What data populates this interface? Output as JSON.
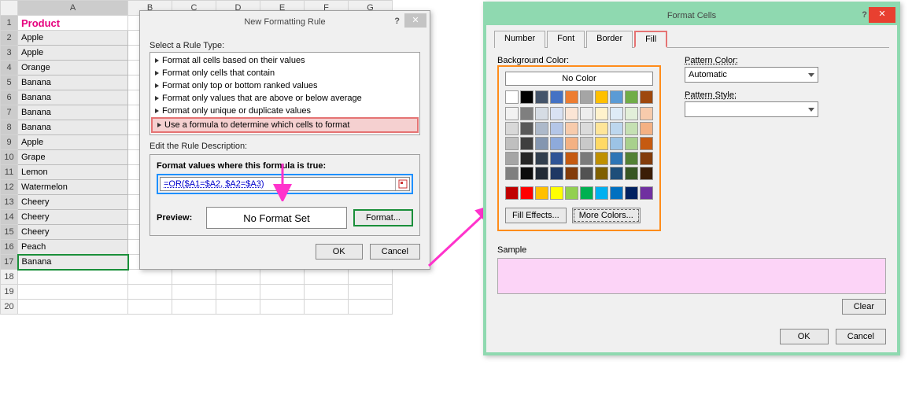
{
  "sheet": {
    "cols": [
      "A",
      "B",
      "C",
      "D",
      "E",
      "F",
      "G"
    ],
    "rows": [
      "1",
      "2",
      "3",
      "4",
      "5",
      "6",
      "7",
      "8",
      "9",
      "10",
      "11",
      "12",
      "13",
      "14",
      "15",
      "16",
      "17",
      "18",
      "19",
      "20"
    ],
    "header_cell": "Product",
    "data": [
      "Apple",
      "Apple",
      "Orange",
      "Banana",
      "Banana",
      "Banana",
      "Banana",
      "Apple",
      "Grape",
      "Lemon",
      "Watermelon",
      "Cheery",
      "Cheery",
      "Cheery",
      "Peach",
      "Banana"
    ]
  },
  "dlg1": {
    "title": "New Formatting Rule",
    "select_label": "Select a Rule Type:",
    "rules": [
      "Format all cells based on their values",
      "Format only cells that contain",
      "Format only top or bottom ranked values",
      "Format only values that are above or below average",
      "Format only unique or duplicate values",
      "Use a formula to determine which cells to format"
    ],
    "selected_rule": 5,
    "edit_label": "Edit the Rule Description:",
    "formula_label": "Format values where this formula is true:",
    "formula_value": "=OR($A1=$A2, $A2=$A3)",
    "preview_label": "Preview:",
    "preview_text": "No Format Set",
    "format_btn": "Format...",
    "ok": "OK",
    "cancel": "Cancel"
  },
  "dlg2": {
    "title": "Format Cells",
    "tabs": [
      "Number",
      "Font",
      "Border",
      "Fill"
    ],
    "active_tab": 3,
    "bg_label": "Background Color:",
    "nocolor": "No Color",
    "fill_effects": "Fill Effects...",
    "more_colors": "More Colors...",
    "pat_color_label": "Pattern Color:",
    "pat_color_value": "Automatic",
    "pat_style_label": "Pattern Style:",
    "sample_label": "Sample",
    "sample_color": "#fcd4f7",
    "clear": "Clear",
    "ok": "OK",
    "cancel": "Cancel",
    "theme_colors": [
      "#ffffff",
      "#000000",
      "#44546a",
      "#4472c4",
      "#ed7d31",
      "#a5a5a5",
      "#ffc000",
      "#5b9bd5",
      "#70ad47",
      "#9e480e"
    ],
    "tints": [
      [
        "#f2f2f2",
        "#7f7f7f",
        "#d6dce4",
        "#d9e2f3",
        "#fbe5d5",
        "#ededed",
        "#fff2cc",
        "#deebf6",
        "#e2efd9",
        "#f7cbac"
      ],
      [
        "#d8d8d8",
        "#595959",
        "#adb9ca",
        "#b4c6e7",
        "#f7cbac",
        "#dbdbdb",
        "#fee599",
        "#bdd7ee",
        "#c5e0b3",
        "#f4b183"
      ],
      [
        "#bfbfbf",
        "#3f3f3f",
        "#8496b0",
        "#8eaadb",
        "#f4b183",
        "#c9c9c9",
        "#ffd965",
        "#9cc3e5",
        "#a8d08d",
        "#c55a11"
      ],
      [
        "#a5a5a5",
        "#262626",
        "#323f4f",
        "#2f5496",
        "#c55a11",
        "#7b7b7b",
        "#bf9000",
        "#2e75b5",
        "#538135",
        "#833c0b"
      ],
      [
        "#7f7f7f",
        "#0c0c0c",
        "#222a35",
        "#1f3864",
        "#833c0b",
        "#525252",
        "#7f6000",
        "#1e4e79",
        "#375623",
        "#3b1d06"
      ]
    ],
    "std_colors": [
      "#c00000",
      "#ff0000",
      "#ffc000",
      "#ffff00",
      "#92d050",
      "#00b050",
      "#00b0f0",
      "#0070c0",
      "#002060",
      "#7030a0"
    ]
  }
}
